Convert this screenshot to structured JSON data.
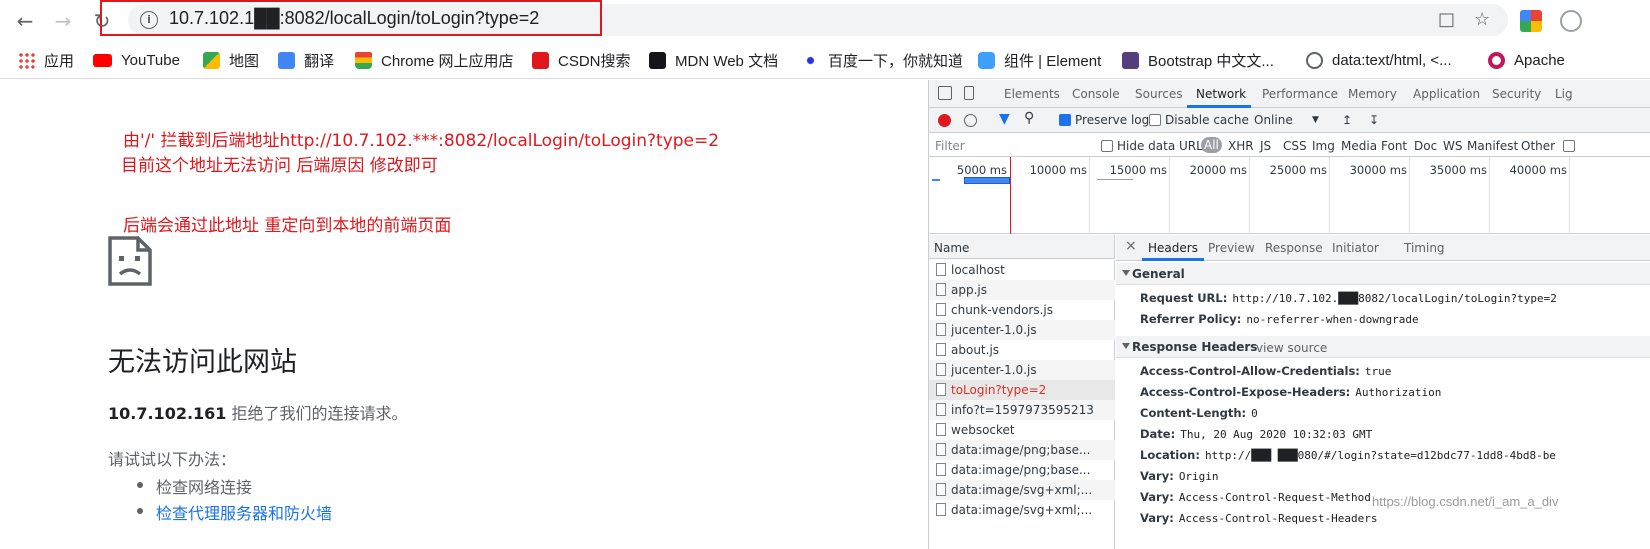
{
  "browser": {
    "url": "10.7.102.1██:8082/localLogin/toLogin?type=2",
    "nav": {
      "back": "←",
      "forward": "→",
      "reload": "↻"
    },
    "bookmarks": [
      {
        "label": "应用",
        "icon": "apps-grid-icon",
        "color": "#4285f4"
      },
      {
        "label": "YouTube",
        "icon": "youtube-icon",
        "color": "#ff0000"
      },
      {
        "label": "地图",
        "icon": "maps-icon",
        "color": "#34a853"
      },
      {
        "label": "翻译",
        "icon": "translate-icon",
        "color": "#4285f4"
      },
      {
        "label": "Chrome 网上应用店",
        "icon": "chrome-store-icon",
        "color": "#fbbc04"
      },
      {
        "label": "CSDN搜索",
        "icon": "csdn-icon",
        "color": "#e0171c"
      },
      {
        "label": "MDN Web 文档",
        "icon": "mdn-icon",
        "color": "#15141a"
      },
      {
        "label": "百度一下，你就知道",
        "icon": "baidu-icon",
        "color": "#2932e1"
      },
      {
        "label": "组件 | Element",
        "icon": "element-icon",
        "color": "#409eff"
      },
      {
        "label": "Bootstrap 中文文...",
        "icon": "bootstrap-icon",
        "color": "#563d7c"
      },
      {
        "label": "data:text/html, <...",
        "icon": "globe-icon",
        "color": "#5f6368"
      },
      {
        "label": "Apache",
        "icon": "apache-icon",
        "color": "#c2185b"
      }
    ]
  },
  "page": {
    "annotations": [
      "由'/'  拦截到后端地址http://10.7.102.***:8082/localLogin/toLogin?type=2",
      "目前这个地址无法访问 后端原因 修改即可",
      "后端会通过此地址 重定向到本地的前端页面"
    ],
    "error_title": "无法访问此网站",
    "error_host": "10.7.102.161",
    "error_desc": " 拒绝了我们的连接请求。",
    "try_label": "请试试以下办法：",
    "suggestions": [
      "检查网络连接",
      "检查代理服务器和防火墙"
    ]
  },
  "devtools": {
    "tabs": [
      "Elements",
      "Console",
      "Sources",
      "Network",
      "Performance",
      "Memory",
      "Application",
      "Security",
      "Lig"
    ],
    "active_tab": "Network",
    "toolbar": {
      "preserve_log": "Preserve log",
      "disable_cache": "Disable cache",
      "throttle": "Online",
      "throttle_arrow": "▼"
    },
    "filter": {
      "placeholder": "Filter",
      "hide_data_urls": "Hide data URLs",
      "types": [
        "All",
        "XHR",
        "JS",
        "CSS",
        "Img",
        "Media",
        "Font",
        "Doc",
        "WS",
        "Manifest",
        "Other"
      ]
    },
    "timeline_ticks": [
      "5000 ms",
      "10000 ms",
      "15000 ms",
      "20000 ms",
      "25000 ms",
      "30000 ms",
      "35000 ms",
      "40000 ms"
    ],
    "name_header": "Name",
    "requests": [
      "localhost",
      "app.js",
      "chunk-vendors.js",
      "jucenter-1.0.js",
      "about.js",
      "jucenter-1.0.js",
      "toLogin?type=2",
      "info?t=1597973595213",
      "websocket",
      "data:image/png;base...",
      "data:image/png;base...",
      "data:image/svg+xml;...",
      "data:image/svg+xml;..."
    ],
    "error_request_index": 6,
    "detail_tabs": [
      "Headers",
      "Preview",
      "Response",
      "Initiator",
      "Timing"
    ],
    "close": "×",
    "general_label": "General",
    "general": [
      {
        "key": "Request URL:",
        "value": "http://10.7.102.███8082/localLogin/toLogin?type=2"
      },
      {
        "key": "Referrer Policy:",
        "value": "no-referrer-when-downgrade"
      }
    ],
    "response_headers_label": "Response Headers",
    "view_source": "view source",
    "response_headers": [
      {
        "key": "Access-Control-Allow-Credentials:",
        "value": "true"
      },
      {
        "key": "Access-Control-Expose-Headers:",
        "value": "Authorization"
      },
      {
        "key": "Content-Length:",
        "value": "0"
      },
      {
        "key": "Date:",
        "value": "Thu, 20 Aug 2020 10:32:03 GMT"
      },
      {
        "key": "Location:",
        "value": "http://███ ███080/#/login?state=d12bdc77-1dd8-4bd8-be"
      },
      {
        "key": "Vary:",
        "value": "Origin"
      },
      {
        "key": "Vary:",
        "value": "Access-Control-Request-Method"
      },
      {
        "key": "Vary:",
        "value": "Access-Control-Request-Headers"
      }
    ]
  },
  "watermark": "https://blog.csdn.net/i_am_a_div"
}
